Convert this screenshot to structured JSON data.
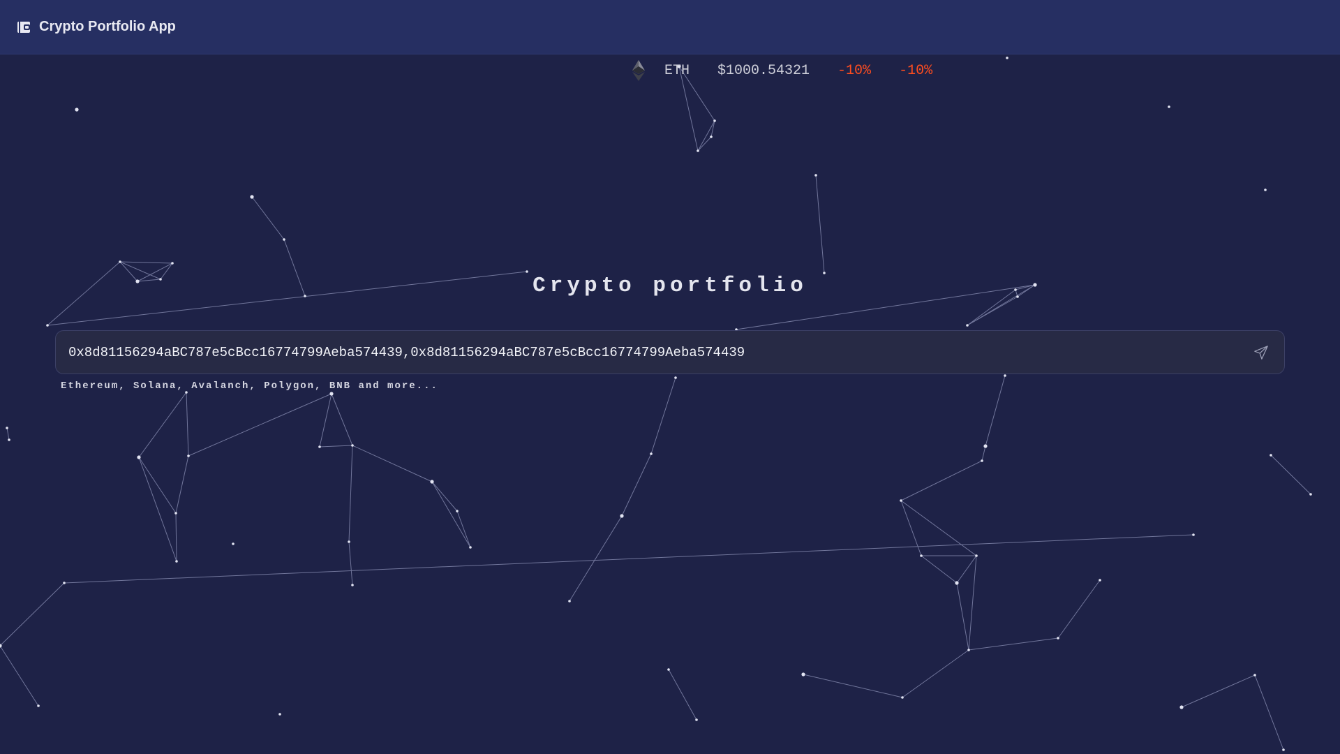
{
  "app": {
    "title": "Crypto Portfolio App",
    "icon": "wallet-icon"
  },
  "ticker": {
    "icon": "ethereum-icon",
    "symbol": "ETH",
    "price": "$1000.54321",
    "change_1": "-10%",
    "change_2": "-10%"
  },
  "main": {
    "title": "Crypto portfolio",
    "search": {
      "value": "0x8d81156294aBC787e5cBcc16774799Aeba574439,0x8d81156294aBC787e5cBcc16774799Aeba574439",
      "submit_icon": "send-icon"
    },
    "hint": "Ethereum, Solana, Avalanch, Polygon, BNB and more..."
  },
  "colors": {
    "background": "#1e2247",
    "topbar": "#262f62",
    "negative_change": "#ff4d1f",
    "network_lines": "#9aa0c8"
  }
}
